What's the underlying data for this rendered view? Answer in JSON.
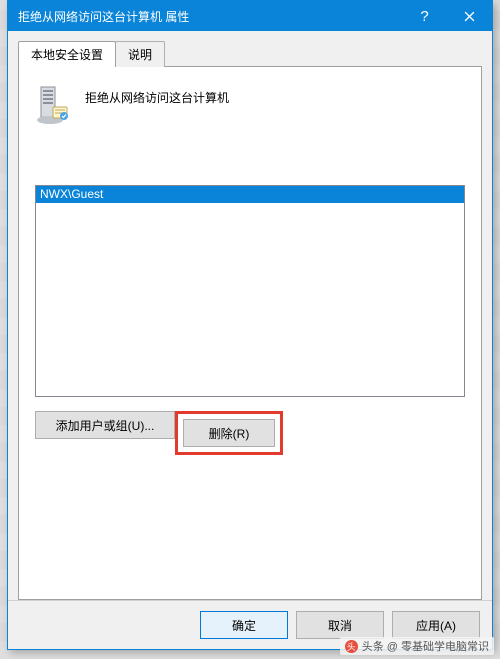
{
  "title_bar": {
    "title": "拒绝从网络访问这台计算机 属性",
    "help_symbol": "?",
    "close_label": "Close"
  },
  "tabs": {
    "local_security": "本地安全设置",
    "explain": "说明"
  },
  "policy": {
    "label": "拒绝从网络访问这台计算机"
  },
  "user_list": {
    "items": [
      "NWX\\Guest"
    ]
  },
  "buttons": {
    "add_user_group": "添加用户或组(U)...",
    "remove": "删除(R)",
    "ok": "确定",
    "cancel": "取消",
    "apply": "应用(A)"
  },
  "watermark": {
    "icon_glyph": "头",
    "text": "头条 @ 零基础学电脑常识"
  }
}
